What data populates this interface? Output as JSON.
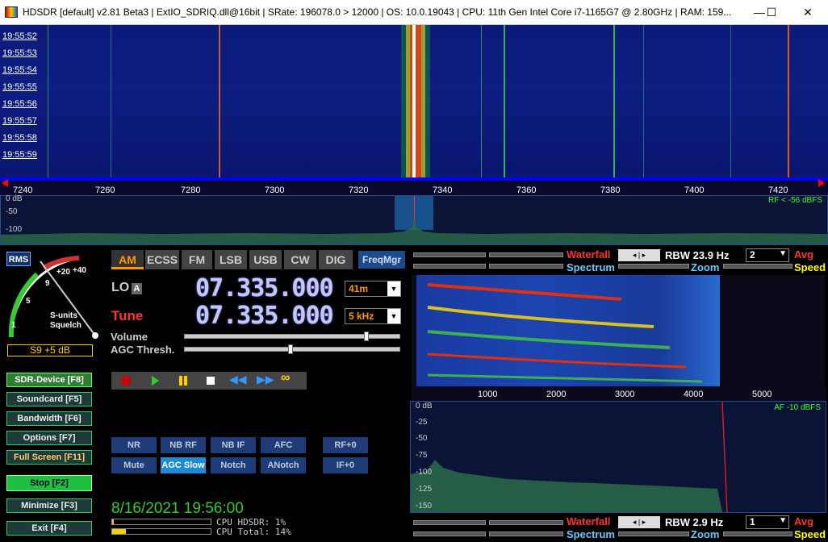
{
  "window": {
    "title": "HDSDR  [default]  v2.81 Beta3  |  ExtIO_SDRIQ.dll@16bit  |  SRate: 196078.0 > 12000  |  OS: 10.0.19043  |  CPU: 11th Gen Intel Core i7-1165G7 @ 2.80GHz  |  RAM: 159...",
    "minimize": "—",
    "maximize": "☐",
    "close": "✕"
  },
  "waterfall": {
    "timestamps": [
      "19:55:52",
      "19:55:53",
      "19:55:54",
      "19:55:55",
      "19:55:56",
      "19:55:57",
      "19:55:58",
      "19:55:59"
    ]
  },
  "scale": {
    "ticks": [
      "7240",
      "7260",
      "7280",
      "7300",
      "7320",
      "7340",
      "7360",
      "7380",
      "7400",
      "7420"
    ]
  },
  "spectrum": {
    "db_labels": [
      "0 dB",
      "-50",
      "-100"
    ],
    "rf_label": "RF < -56 dBFS"
  },
  "meter": {
    "rms": "RMS",
    "scale": [
      "+40",
      "+20",
      "9",
      "5",
      "1"
    ],
    "units": "S-units",
    "squelch": "Squelch",
    "reading": "S9 +5 dB"
  },
  "modes": [
    "AM",
    "ECSS",
    "FM",
    "LSB",
    "USB",
    "CW",
    "DIG"
  ],
  "freqmgr": "FreqMgr",
  "lo": {
    "label": "LO",
    "a": "A",
    "freq": "07.335.000",
    "band": "41m"
  },
  "tune": {
    "label": "Tune",
    "freq": "07.335.000",
    "step": "5 kHz"
  },
  "volume_label": "Volume",
  "agc_label": "AGC Thresh.",
  "left_buttons": [
    "SDR-Device [F8]",
    "Soundcard  [F5]",
    "Bandwidth  [F6]",
    "Options  [F7]",
    "Full Screen  [F11]",
    "Stop  [F2]",
    "Minimize  [F3]",
    "Exit  [F4]"
  ],
  "filters": {
    "row1": [
      "NR",
      "NB RF",
      "NB IF",
      "AFC",
      "RF+0"
    ],
    "row2": [
      "Mute",
      "AGC Slow",
      "Notch",
      "ANotch",
      "IF+0"
    ]
  },
  "datetime": "8/16/2021 19:56:00",
  "cpu": {
    "hdsdr": "CPU HDSDR:  1%",
    "total": "CPU Total: 14%"
  },
  "top_panel": {
    "waterfall": "Waterfall",
    "rbw": "RBW 23.9 Hz",
    "avg_val": "2",
    "avg": "Avg",
    "spectrum": "Spectrum",
    "zoom": "Zoom",
    "speed": "Speed"
  },
  "audio_scale": [
    "1000",
    "2000",
    "3000",
    "4000",
    "5000"
  ],
  "audio_spec": {
    "db_labels": [
      "0 dB",
      "-25",
      "-50",
      "-75",
      "-100",
      "-125",
      "-150"
    ],
    "af_label": "AF -10 dBFS"
  },
  "bottom_panel": {
    "waterfall": "Waterfall",
    "rbw": "RBW  2.9 Hz",
    "avg_val": "1",
    "avg": "Avg",
    "spectrum": "Spectrum",
    "zoom": "Zoom",
    "speed": "Speed"
  }
}
